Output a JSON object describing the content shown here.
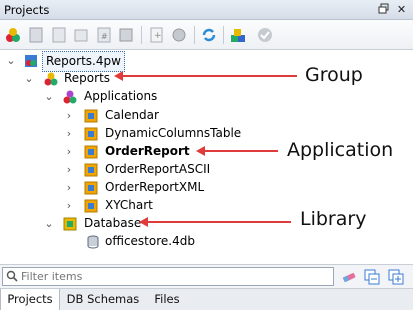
{
  "panel": {
    "title": "Projects",
    "pin_icon": "pin-icon",
    "close_icon": "close-icon"
  },
  "tree": {
    "root": "Reports.4pw",
    "reports": "Reports",
    "applications": "Applications",
    "apps": [
      "Calendar",
      "DynamicColumnsTable",
      "OrderReport",
      "OrderReportASCII",
      "OrderReportXML",
      "XYChart"
    ],
    "database": "Database",
    "db_file": "officestore.4db"
  },
  "annotations": {
    "group": "Group",
    "application": "Application",
    "library": "Library"
  },
  "filter": {
    "placeholder": "Filter items"
  },
  "tabs": [
    "Projects",
    "DB Schemas",
    "Files"
  ],
  "colors": {
    "arrow": "#e03b3b",
    "selection_border": "#3a6ea5"
  }
}
